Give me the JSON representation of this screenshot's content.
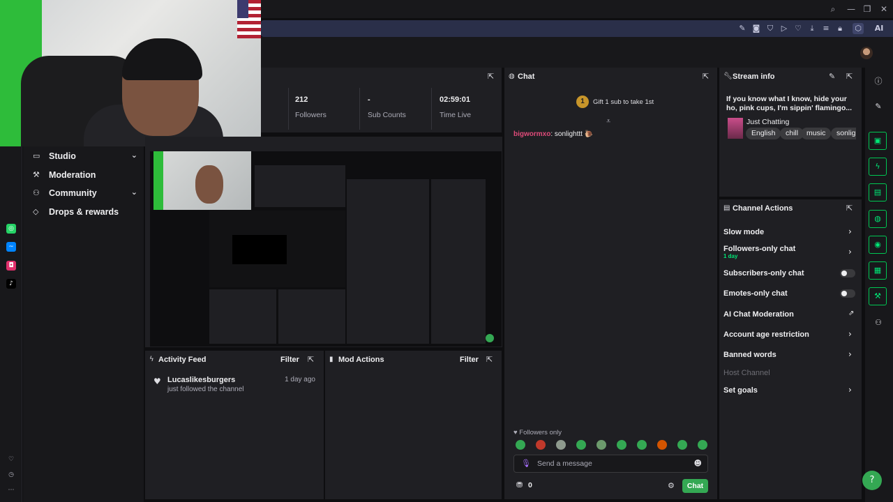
{
  "window": {
    "controls": [
      "search-icon",
      "minimize-icon",
      "restore-icon",
      "close-icon"
    ]
  },
  "address_bar": {
    "icons": [
      "edit-icon",
      "camera-icon",
      "shield-icon",
      "play-icon",
      "heart-icon",
      "download-icon",
      "menu-icon",
      "lock-icon",
      "extension-icon"
    ],
    "ai_label": "AI"
  },
  "sidenav": {
    "items": [
      {
        "label": "Studio",
        "icon": "studio-icon",
        "has_chevron": true
      },
      {
        "label": "Moderation",
        "icon": "moderation-icon",
        "has_chevron": false
      },
      {
        "label": "Community",
        "icon": "community-icon",
        "has_chevron": true
      },
      {
        "label": "Drops & rewards",
        "icon": "drops-icon",
        "has_chevron": false
      }
    ]
  },
  "stats": [
    {
      "value": "212",
      "label": "Followers"
    },
    {
      "value": "-",
      "label": "Sub Counts"
    },
    {
      "value": "02:59:01",
      "label": "Time Live"
    }
  ],
  "chat": {
    "title": "Chat",
    "gift_prompt": "Gift 1 sub to take 1st",
    "gift_rank": "1",
    "messages": [
      {
        "user": "bigwormxo",
        "sep": ":",
        "text": "sonlighttt 🐌"
      }
    ],
    "followers_only": "Followers only",
    "input_placeholder": "Send a message",
    "points": "0",
    "send_label": "Chat",
    "user_color": "#e04b7a"
  },
  "stream_info": {
    "title": "Stream info",
    "stream_title": "If you know what I know, hide your ho, pink cups, I'm sippin' flamingo...",
    "category": "Just Chatting",
    "tags": [
      "English",
      "chill",
      "music",
      "sonlig"
    ]
  },
  "channel_actions": {
    "title": "Channel Actions",
    "items": [
      {
        "label": "Slow mode",
        "control": "chevron"
      },
      {
        "label": "Followers-only chat",
        "sublabel": "1 day",
        "control": "chevron"
      },
      {
        "label": "Subscribers-only chat",
        "control": "toggle"
      },
      {
        "label": "Emotes-only chat",
        "control": "toggle"
      },
      {
        "label": "AI Chat Moderation",
        "control": "external"
      },
      {
        "label": "Account age restriction",
        "control": "chevron"
      },
      {
        "label": "Banned words",
        "control": "chevron"
      },
      {
        "label": "Host Channel",
        "control": "none",
        "disabled": true
      },
      {
        "label": "Set goals",
        "control": "chevron"
      }
    ]
  },
  "activity_feed": {
    "title": "Activity Feed",
    "filter_label": "Filter",
    "items": [
      {
        "user": "Lucaslikesburgers",
        "action": "just followed the channel",
        "time": "1 day ago"
      }
    ]
  },
  "mod_actions": {
    "title": "Mod Actions",
    "filter_label": "Filter"
  },
  "colors": {
    "accent": "#34a853",
    "bg": "#0e0e10",
    "panel": "#1f1f23",
    "gift_badge": "#c7952a",
    "address_bar": "#2a2f49"
  },
  "right_rail_icons": [
    "clip-icon",
    "lightning-icon",
    "notes-icon",
    "chat-bubble-icon",
    "broadcast-icon",
    "layout-icon",
    "wrench-icon",
    "people-icon"
  ]
}
